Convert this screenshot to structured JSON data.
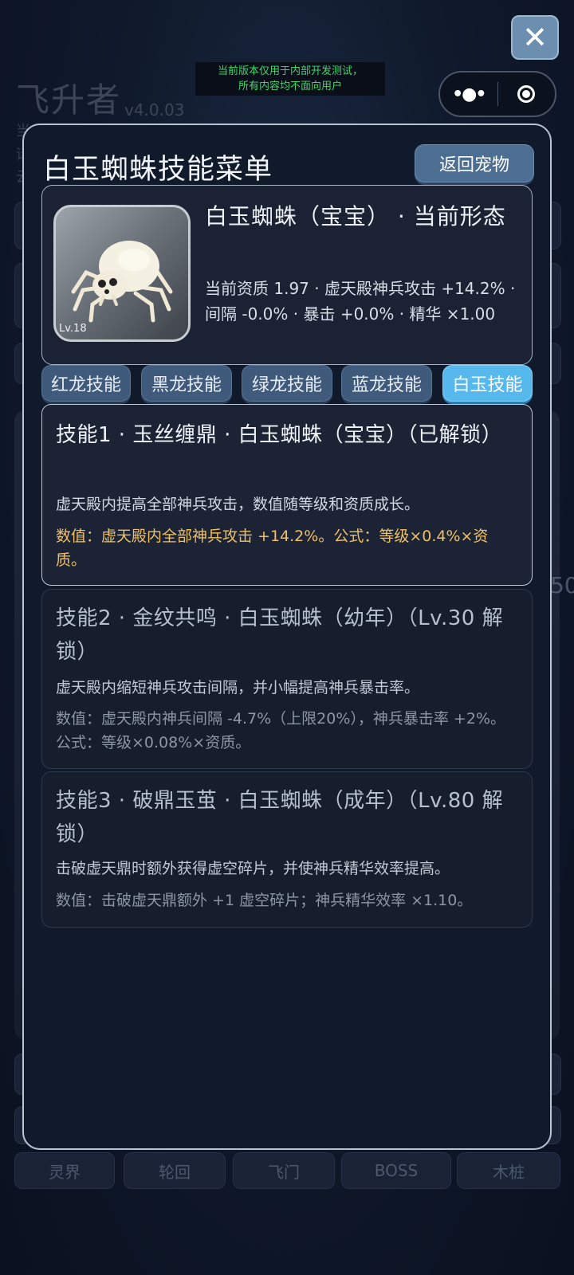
{
  "background": {
    "app_title": "飞升者",
    "version": "v4.0.03",
    "side_fragments": [
      "当",
      "话",
      "云"
    ],
    "edge_number": "50",
    "bottom_nav": [
      "灵界",
      "轮回",
      "飞门",
      "BOSS",
      "木桩"
    ]
  },
  "notice": {
    "line1": "当前版本仅用于内部开发测试，",
    "line2": "所有内容均不面向用户"
  },
  "modal": {
    "title": "白玉蜘蛛技能菜单",
    "back_label": "返回宠物",
    "pet": {
      "level_label": "Lv.18",
      "name": "白玉蜘蛛（宝宝） · 当前形态",
      "stats": "当前资质 1.97 · 虚天殿神兵攻击 +14.2% · 间隔 -0.0% · 暴击 +0.0% · 精华 ×1.00"
    },
    "tabs": [
      {
        "label": "红龙技能",
        "active": false
      },
      {
        "label": "黑龙技能",
        "active": false
      },
      {
        "label": "绿龙技能",
        "active": false
      },
      {
        "label": "蓝龙技能",
        "active": false
      },
      {
        "label": "白玉技能",
        "active": true
      }
    ],
    "skills": [
      {
        "title": "技能1 · 玉丝缠鼎 · 白玉蜘蛛（宝宝）（已解锁）",
        "desc": "虚天殿内提高全部神兵攻击，数值随等级和资质成长。",
        "value": "数值：虚天殿内全部神兵攻击 +14.2%。公式：等级×0.4%×资质。",
        "unlocked": true
      },
      {
        "title": "技能2 · 金纹共鸣 · 白玉蜘蛛（幼年）（Lv.30 解锁）",
        "desc": "虚天殿内缩短神兵攻击间隔，并小幅提高神兵暴击率。",
        "value": "数值：虚天殿内神兵间隔 -4.7%（上限20%），神兵暴击率 +2%。公式：等级×0.08%×资质。",
        "unlocked": false
      },
      {
        "title": "技能3 · 破鼎玉茧 · 白玉蜘蛛（成年）（Lv.80 解锁）",
        "desc": "击破虚天鼎时额外获得虚空碎片，并使神兵精华效率提高。",
        "value": "数值：击破虚天鼎额外 +1 虚空碎片；神兵精华效率 ×1.10。",
        "unlocked": false
      }
    ]
  },
  "colors": {
    "accent_tab": "#56b8ec",
    "tab": "#3f5a7a",
    "value_highlight": "#f0c064",
    "notice_text": "#3fd46a"
  },
  "icons": {
    "close": "close-icon",
    "more": "more-dots-icon",
    "capsule_target": "target-circle-icon",
    "pet_avatar": "white-spider-icon"
  }
}
